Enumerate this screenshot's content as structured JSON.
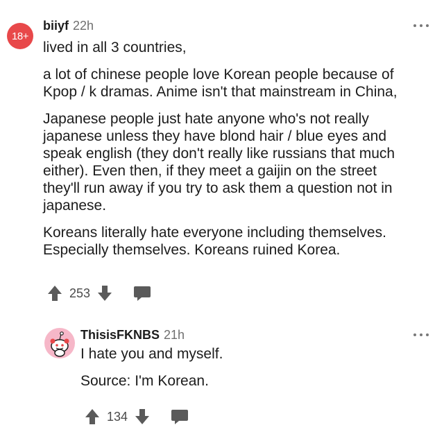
{
  "comments": [
    {
      "avatar_label": "18+",
      "username": "biiyf",
      "time": "22h",
      "paragraphs": [
        [
          "lived in all 3 countries,"
        ],
        [
          "a lot of chinese people love Korean people because of",
          "Kpop / k dramas. Anime isn't that mainstream in China,"
        ],
        [
          "Japanese people just hate anyone who's not really",
          "japanese unless they have blond hair / blue eyes and",
          "speak english (they don't really like russians that much",
          "either). Even then, if they meet a gaijin on the street",
          "they'll run away if you try to ask them a question not in",
          "japanese."
        ],
        [
          "Koreans literally hate everyone including themselves.",
          "Especially themselves. Koreans ruined Korea."
        ]
      ],
      "votes": "253"
    },
    {
      "username": "ThisisFKNBS",
      "time": "21h",
      "paragraphs": [
        [
          "I hate you and myself."
        ],
        [
          "Source: I'm Korean."
        ]
      ],
      "votes": "134"
    }
  ],
  "icons": {
    "upvote": "up-arrow-icon",
    "downvote": "down-arrow-icon",
    "reply": "reply-bubble-icon",
    "more": "more-options-icon",
    "avatar_snoo": "snoo-avatar-icon"
  },
  "colors": {
    "nsfw_badge": "#e8484a",
    "snoo_avatar_bg": "#f6b7c8",
    "icon_gray": "#5a5a5a",
    "meta_gray": "#6f6f6f"
  }
}
